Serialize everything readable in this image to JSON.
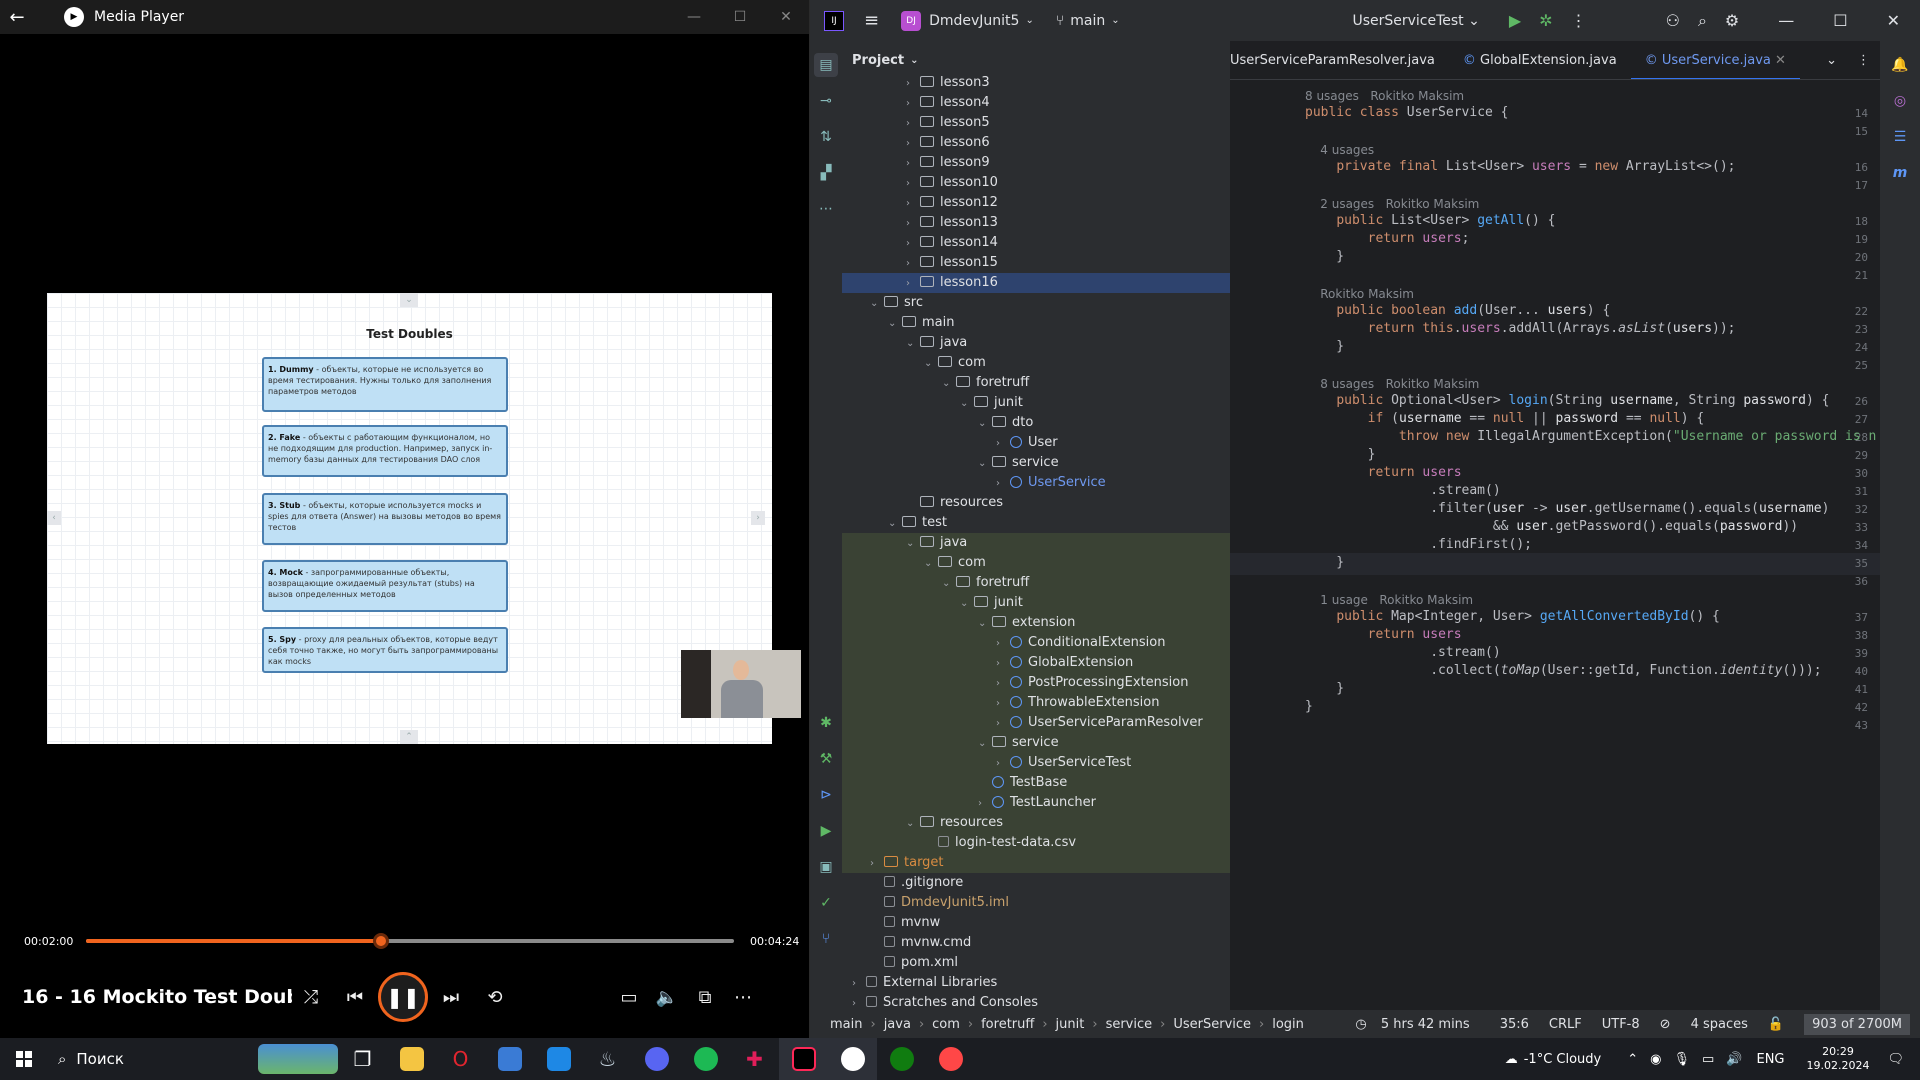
{
  "media_player": {
    "title": "Media Player",
    "time_current": "00:02:00",
    "time_total": "00:04:24",
    "progress": 0.4545,
    "now_playing": "16 - 16 Mockito Test Doubl...",
    "slide": {
      "title": "Test Doubles",
      "cards": [
        {
          "bold": "1. Dummy",
          "text": " - объекты, которые не используется во время тестирования. Нужны только для заполнения параметров методов"
        },
        {
          "bold": "2. Fake",
          "text": " - объекты с работающим функционалом, но не подходящим для production. Например, запуск in-memory базы данных для тестирования DAO слоя"
        },
        {
          "bold": "3. Stub",
          "text": " - объекты, которые используется mocks и spies для ответа (Answer) на вызовы методов во время тестов"
        },
        {
          "bold": "4. Mock",
          "text": " - запрограммированные объекты, возвращающие ожидаемый результат (stubs) на вызов определенных методов"
        },
        {
          "bold": "5. Spy",
          "text": " - proxy для реальных объектов, которые ведут себя точно также, но могут быть запрограммированы как mocks"
        }
      ]
    }
  },
  "ide": {
    "project_name": "DmdevJunit5",
    "branch": "main",
    "run_config": "UserServiceTest",
    "panel_title": "Project",
    "tabs": [
      "UserServiceParamResolver.java",
      "GlobalExtension.java",
      "UserService.java"
    ],
    "tree": [
      {
        "label": "lesson3",
        "indent": 3,
        "chev": "›",
        "type": "folder"
      },
      {
        "label": "lesson4",
        "indent": 3,
        "chev": "›",
        "type": "folder"
      },
      {
        "label": "lesson5",
        "indent": 3,
        "chev": "›",
        "type": "folder"
      },
      {
        "label": "lesson6",
        "indent": 3,
        "chev": "›",
        "type": "folder"
      },
      {
        "label": "lesson9",
        "indent": 3,
        "chev": "›",
        "type": "folder"
      },
      {
        "label": "lesson10",
        "indent": 3,
        "chev": "›",
        "type": "folder"
      },
      {
        "label": "lesson12",
        "indent": 3,
        "chev": "›",
        "type": "folder"
      },
      {
        "label": "lesson13",
        "indent": 3,
        "chev": "›",
        "type": "folder"
      },
      {
        "label": "lesson14",
        "indent": 3,
        "chev": "›",
        "type": "folder"
      },
      {
        "label": "lesson15",
        "indent": 3,
        "chev": "›",
        "type": "folder"
      },
      {
        "label": "lesson16",
        "indent": 3,
        "chev": "›",
        "type": "folder",
        "sel": true
      },
      {
        "label": "src",
        "indent": 1,
        "chev": "⌄",
        "type": "folder"
      },
      {
        "label": "main",
        "indent": 2,
        "chev": "⌄",
        "type": "folder"
      },
      {
        "label": "java",
        "indent": 3,
        "chev": "⌄",
        "type": "folder"
      },
      {
        "label": "com",
        "indent": 4,
        "chev": "⌄",
        "type": "folder"
      },
      {
        "label": "foretruff",
        "indent": 5,
        "chev": "⌄",
        "type": "folder"
      },
      {
        "label": "junit",
        "indent": 6,
        "chev": "⌄",
        "type": "folder"
      },
      {
        "label": "dto",
        "indent": 7,
        "chev": "⌄",
        "type": "folder"
      },
      {
        "label": "User",
        "indent": 8,
        "chev": "›",
        "type": "class"
      },
      {
        "label": "service",
        "indent": 7,
        "chev": "⌄",
        "type": "folder"
      },
      {
        "label": "UserService",
        "indent": 8,
        "chev": "›",
        "type": "class",
        "hl": true
      },
      {
        "label": "resources",
        "indent": 3,
        "chev": "",
        "type": "folder"
      },
      {
        "label": "test",
        "indent": 2,
        "chev": "⌄",
        "type": "folder"
      },
      {
        "label": "java",
        "indent": 3,
        "chev": "⌄",
        "type": "folder",
        "test": true
      },
      {
        "label": "com",
        "indent": 4,
        "chev": "⌄",
        "type": "folder",
        "test": true
      },
      {
        "label": "foretruff",
        "indent": 5,
        "chev": "⌄",
        "type": "folder",
        "test": true
      },
      {
        "label": "junit",
        "indent": 6,
        "chev": "⌄",
        "type": "folder",
        "test": true
      },
      {
        "label": "extension",
        "indent": 7,
        "chev": "⌄",
        "type": "folder",
        "test": true
      },
      {
        "label": "ConditionalExtension",
        "indent": 8,
        "chev": "›",
        "type": "class",
        "test": true
      },
      {
        "label": "GlobalExtension",
        "indent": 8,
        "chev": "›",
        "type": "class",
        "test": true
      },
      {
        "label": "PostProcessingExtension",
        "indent": 8,
        "chev": "›",
        "type": "class",
        "test": true
      },
      {
        "label": "ThrowableExtension",
        "indent": 8,
        "chev": "›",
        "type": "class",
        "test": true
      },
      {
        "label": "UserServiceParamResolver",
        "indent": 8,
        "chev": "›",
        "type": "class",
        "test": true
      },
      {
        "label": "service",
        "indent": 7,
        "chev": "⌄",
        "type": "folder",
        "test": true
      },
      {
        "label": "UserServiceTest",
        "indent": 8,
        "chev": "›",
        "type": "class",
        "test": true
      },
      {
        "label": "TestBase",
        "indent": 7,
        "chev": "",
        "type": "class",
        "test": true
      },
      {
        "label": "TestLauncher",
        "indent": 7,
        "chev": "›",
        "type": "class",
        "test": true
      },
      {
        "label": "resources",
        "indent": 3,
        "chev": "⌄",
        "type": "folder",
        "test": true
      },
      {
        "label": "login-test-data.csv",
        "indent": 4,
        "chev": "",
        "type": "file",
        "test": true
      },
      {
        "label": "target",
        "indent": 1,
        "chev": "›",
        "type": "folder",
        "orange": true,
        "test": true
      },
      {
        "label": ".gitignore",
        "indent": 1,
        "chev": "",
        "type": "file"
      },
      {
        "label": "DmdevJunit5.iml",
        "indent": 1,
        "chev": "",
        "type": "file",
        "yellow": true
      },
      {
        "label": "mvnw",
        "indent": 1,
        "chev": "",
        "type": "file"
      },
      {
        "label": "mvnw.cmd",
        "indent": 1,
        "chev": "",
        "type": "file"
      },
      {
        "label": "pom.xml",
        "indent": 1,
        "chev": "",
        "type": "file"
      },
      {
        "label": "External Libraries",
        "indent": 0,
        "chev": "›",
        "type": "file"
      },
      {
        "label": "Scratches and Consoles",
        "indent": 0,
        "chev": "›",
        "type": "file"
      }
    ],
    "editor_lines": [
      {
        "n": "13",
        "html": ""
      },
      {
        "hint": "8 usages   Rokitko Maksim"
      },
      {
        "n": "14",
        "html": "<span class='kw'>public class</span> UserService {"
      },
      {
        "n": "15",
        "html": ""
      },
      {
        "hint": "    4 usages"
      },
      {
        "n": "16",
        "html": "    <span class='kw'>private final</span> List&lt;User&gt; <span class='fld'>users</span> = <span class='kw'>new</span> ArrayList&lt;&gt;();"
      },
      {
        "n": "17",
        "html": ""
      },
      {
        "hint": "    2 usages   Rokitko Maksim"
      },
      {
        "n": "18",
        "html": "    <span class='kw'>public</span> List&lt;User&gt; <span class='fn'>getAll</span>() {"
      },
      {
        "n": "19",
        "html": "        <span class='kw'>return</span> <span class='fld'>users</span>;"
      },
      {
        "n": "20",
        "html": "    }"
      },
      {
        "n": "21",
        "html": ""
      },
      {
        "hint": "    Rokitko Maksim"
      },
      {
        "n": "22",
        "html": "    <span class='kw'>public boolean</span> <span class='fn'>add</span>(User... <span class='param'>users</span>) {"
      },
      {
        "n": "23",
        "html": "        <span class='kw'>return this</span>.<span class='fld'>users</span>.addAll(Arrays.<span class='it'>asList</span>(<span class='param'>users</span>));"
      },
      {
        "n": "24",
        "html": "    }"
      },
      {
        "n": "25",
        "html": ""
      },
      {
        "hint": "    8 usages   Rokitko Maksim"
      },
      {
        "n": "26",
        "html": "    <span class='kw'>public</span> Optional&lt;User&gt; <span class='fn'>login</span>(String <span class='param'>username</span>, String <span class='param'>password</span>) {"
      },
      {
        "n": "27",
        "html": "        <span class='kw'>if</span> (<span class='param'>username</span> == <span class='kw'>null</span> || <span class='param'>password</span> == <span class='kw'>null</span>) {"
      },
      {
        "n": "28",
        "html": "            <span class='kw'>throw new</span> IllegalArgumentException(<span class='str'>\"Username or password is n</span>"
      },
      {
        "n": "29",
        "html": "        }"
      },
      {
        "n": "30",
        "html": "        <span class='kw'>return</span> <span class='fld'>users</span>"
      },
      {
        "n": "31",
        "html": "                .stream()"
      },
      {
        "n": "32",
        "html": "                .filter(<span class='param'>user</span> -&gt; <span class='param'>user</span>.getUsername().equals(<span class='param'>username</span>)"
      },
      {
        "n": "33",
        "html": "                        &amp;&amp; <span class='param'>user</span>.getPassword().equals(<span class='param'>password</span>))"
      },
      {
        "n": "34",
        "html": "                .findFirst();"
      },
      {
        "n": "35",
        "html": "    }",
        "cursor": true
      },
      {
        "n": "36",
        "html": ""
      },
      {
        "hint": "    1 usage   Rokitko Maksim"
      },
      {
        "n": "37",
        "html": "    <span class='kw'>public</span> Map&lt;Integer, User&gt; <span class='fn'>getAllConvertedById</span>() {"
      },
      {
        "n": "38",
        "html": "        <span class='kw'>return</span> <span class='fld'>users</span>"
      },
      {
        "n": "39",
        "html": "                .stream()"
      },
      {
        "n": "40",
        "html": "                .collect(<span class='it'>toMap</span>(User::getId, Function.<span class='it'>identity</span>()));"
      },
      {
        "n": "41",
        "html": "    }"
      },
      {
        "n": "42",
        "html": "}"
      },
      {
        "n": "43",
        "html": ""
      }
    ],
    "status": {
      "breadcrumb": [
        "main",
        "java",
        "com",
        "foretruff",
        "junit",
        "service",
        "UserService",
        "login"
      ],
      "time": "5 hrs 42 mins",
      "position": "35:6",
      "line_sep": "CRLF",
      "encoding": "UTF-8",
      "indent": "4 spaces",
      "memory": "903 of 2700M"
    }
  },
  "taskbar": {
    "search_placeholder": "Поиск",
    "weather": "-1°C  Cloudy",
    "lang": "ENG",
    "time": "20:29",
    "date": "19.02.2024"
  }
}
